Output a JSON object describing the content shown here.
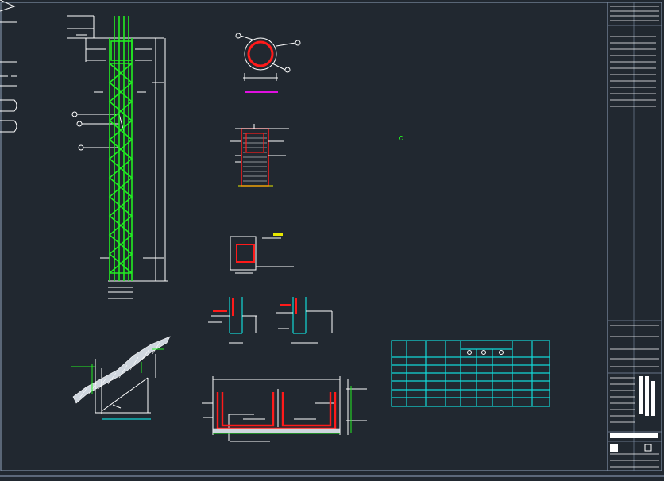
{
  "title_block": {
    "rows": 13,
    "logo": "company-logo-icon"
  },
  "schedule_table": {
    "rows": 7,
    "cols": 9,
    "marker_count": 3
  },
  "colors": {
    "background": "#212830",
    "frame": "#7f8fa6",
    "rebar_green": "#22ee22",
    "rebar_red": "#ff1a1a",
    "table_cyan": "#12d8d8",
    "hatch_white": "#ffffff",
    "accent_magenta": "#e010e0",
    "yellow": "#e8e800"
  },
  "icons": [
    "company-logo-icon",
    "section-marker-icon",
    "origin-marker-icon"
  ]
}
